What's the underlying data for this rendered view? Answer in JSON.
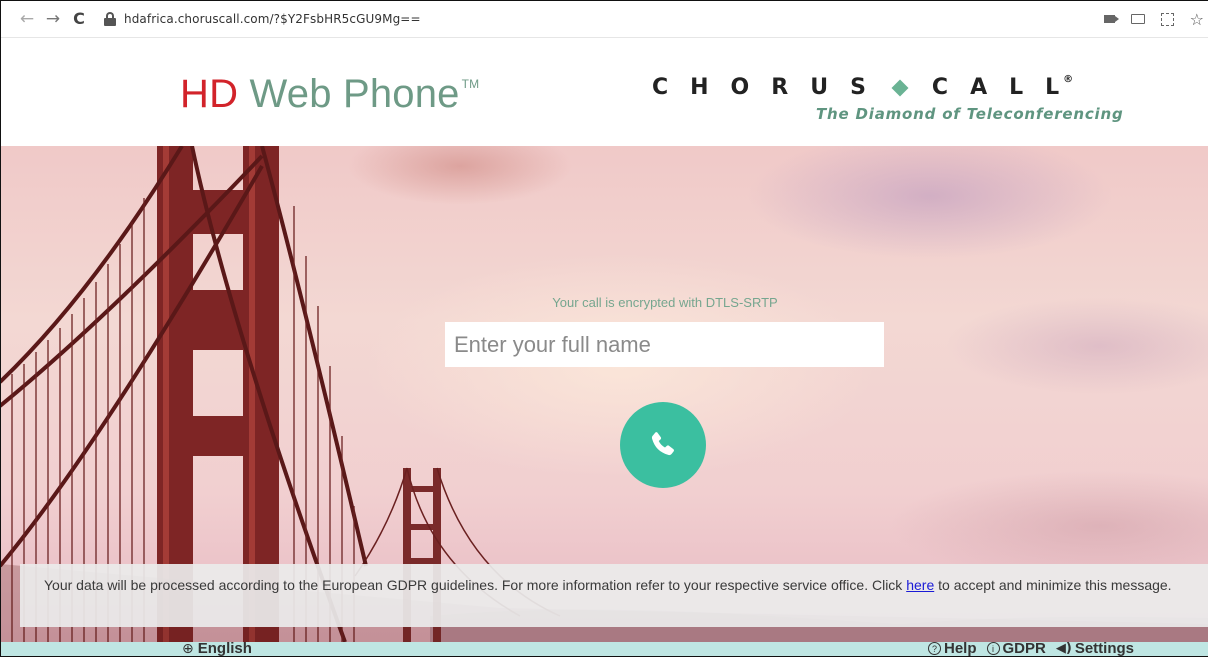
{
  "browser": {
    "url": "hdafrica.choruscall.com/?$Y2FsbHR5cGU9Mg==",
    "icons": [
      "back-icon",
      "forward-icon",
      "reload-icon",
      "lock-icon",
      "camera-icon",
      "cast-icon",
      "qr-icon",
      "star-icon"
    ]
  },
  "header": {
    "logo_hd": "HD",
    "logo_rest": "Web Phone",
    "logo_tm": "TM",
    "brand_left": "CHORUS",
    "brand_right": "CALL",
    "brand_reg": "®",
    "brand_tagline": "The Diamond of Teleconferencing"
  },
  "main": {
    "encryption_notice": "Your call is encrypted with DTLS-SRTP",
    "name_placeholder": "Enter your full name",
    "name_value": "",
    "call_button_icon": "phone-icon"
  },
  "gdpr": {
    "text_before": "Your data will be processed according to the European GDPR guidelines. For more information refer to your respective service office.  Click ",
    "link_text": "here",
    "text_after": " to accept and minimize this message."
  },
  "footer": {
    "language": "English",
    "help": "Help",
    "gdpr": "GDPR",
    "settings": "Settings"
  },
  "colors": {
    "logo_red": "#d2232a",
    "logo_green": "#6e9a86",
    "call_button": "#3bbfa0",
    "footer_bg": "#bfe6e3",
    "link": "#1a1ad6"
  }
}
